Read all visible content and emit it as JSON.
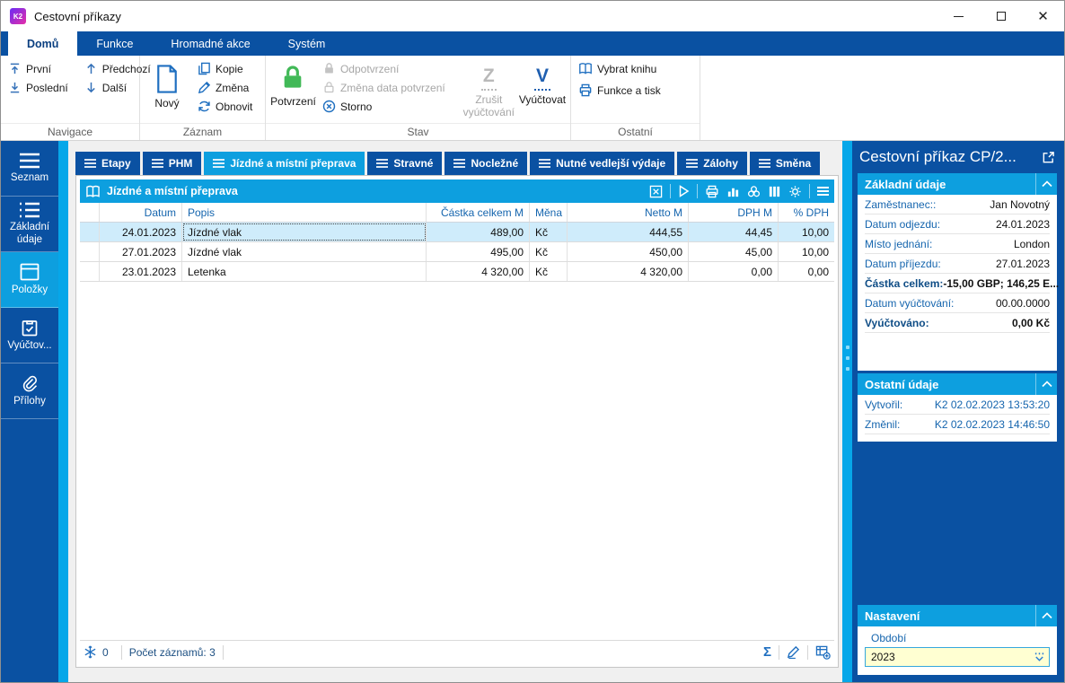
{
  "colors": {
    "dark_blue": "#0a51a2",
    "accent_blue": "#0d9fdf",
    "selected_row": "#cfecfb",
    "confirm_green": "#41b957",
    "input_bg": "#ffffd2"
  },
  "window": {
    "title": "Cestovní příkazy",
    "app_badge": "K2"
  },
  "ribbon": {
    "tabs": {
      "home": "Domů",
      "functions": "Funkce",
      "bulk": "Hromadné akce",
      "system": "Systém"
    },
    "nav": {
      "first": "První",
      "last": "Poslední",
      "prev": "Předchozí",
      "next": "Další",
      "group": "Navigace"
    },
    "record": {
      "new": "Nový",
      "copy": "Kopie",
      "edit": "Změna",
      "refresh": "Obnovit",
      "group": "Záznam"
    },
    "state": {
      "confirm": "Potvrzení",
      "unconfirm": "Odpotvrzení",
      "change_date": "Změna data potvrzení",
      "cancel": "Storno",
      "undo_letter": "Z",
      "undo_settlement": "Zrušit vyúčtování",
      "settle_letter": "V",
      "settle": "Vyúčtovat",
      "group": "Stav"
    },
    "other": {
      "select_book": "Vybrat knihu",
      "functions_print": "Funkce a tisk",
      "group": "Ostatní"
    }
  },
  "nav_sidebar": {
    "items": [
      {
        "label": "Seznam",
        "active": false
      },
      {
        "label": "Základní údaje",
        "active": false
      },
      {
        "label": "Položky",
        "active": true
      },
      {
        "label": "Vyúčtov...",
        "active": false
      },
      {
        "label": "Přílohy",
        "active": false
      }
    ]
  },
  "page_tabs": [
    {
      "label": "Etapy",
      "active": false
    },
    {
      "label": "PHM",
      "active": false
    },
    {
      "label": "Jízdné a místní přeprava",
      "active": true
    },
    {
      "label": "Stravné",
      "active": false
    },
    {
      "label": "Nocležné",
      "active": false
    },
    {
      "label": "Nutné vedlejší výdaje",
      "active": false
    },
    {
      "label": "Zálohy",
      "active": false
    },
    {
      "label": "Směna",
      "active": false
    }
  ],
  "grid": {
    "title": "Jízdné a místní přeprava",
    "columns": [
      "Datum",
      "Popis",
      "Částka celkem M",
      "Měna",
      "Netto M",
      "DPH M",
      "% DPH"
    ],
    "rows": [
      [
        "24.01.2023",
        "Jízdné vlak",
        "489,00",
        "Kč",
        "444,55",
        "44,45",
        "10,00"
      ],
      [
        "27.01.2023",
        "Jízdné vlak",
        "495,00",
        "Kč",
        "450,00",
        "45,00",
        "10,00"
      ],
      [
        "23.01.2023",
        "Letenka",
        "4 320,00",
        "Kč",
        "4 320,00",
        "0,00",
        "0,00"
      ]
    ],
    "status": {
      "flag_count": "0",
      "record_count": "Počet záznamů: 3",
      "sum_glyph": "Σ"
    }
  },
  "detail": {
    "title": "Cestovní příkaz CP/2...",
    "section1": {
      "title": "Základní údaje",
      "fields": [
        {
          "label": "Zaměstnanec::",
          "value": "Jan Novotný"
        },
        {
          "label": "Datum odjezdu:",
          "value": "24.01.2023"
        },
        {
          "label": "Místo jednání:",
          "value": "London"
        },
        {
          "label": "Datum příjezdu:",
          "value": "27.01.2023"
        },
        {
          "label": "Částka celkem:",
          "value": "-15,00 GBP; 146,25 E..."
        },
        {
          "label": "Datum vyúčtování:",
          "value": "00.00.0000"
        },
        {
          "label": "Vyúčtováno:",
          "value": "0,00 Kč"
        }
      ]
    },
    "section2": {
      "title": "Ostatní údaje",
      "fields": [
        {
          "label": "Vytvořil:",
          "value": "K2 02.02.2023 13:53:20"
        },
        {
          "label": "Změnil:",
          "value": "K2 02.02.2023 14:46:50"
        }
      ]
    },
    "section3": {
      "title": "Nastavení",
      "period_label": "Období",
      "period_value": "2023"
    }
  }
}
